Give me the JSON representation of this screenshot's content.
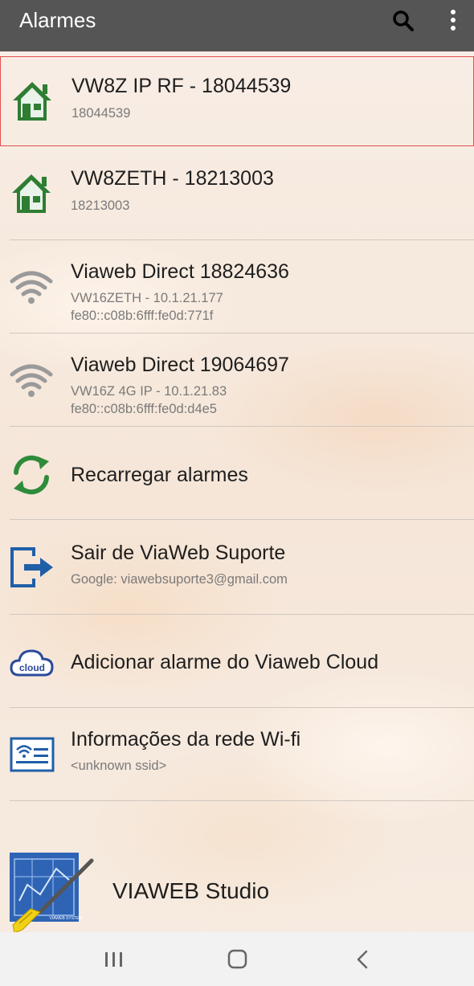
{
  "appbar": {
    "title": "Alarmes",
    "search_icon": "search-icon",
    "more_icon": "more-vert-icon"
  },
  "items": [
    {
      "icon": "house-icon",
      "title": "VW8Z IP RF - 18044539",
      "lines": [
        "18044539"
      ]
    },
    {
      "icon": "house-icon",
      "title": "VW8ZETH - 18213003",
      "lines": [
        "18213003"
      ]
    },
    {
      "icon": "wifi-icon",
      "title": "Viaweb Direct 18824636",
      "lines": [
        "VW16ZETH - 10.1.21.177",
        "fe80::c08b:6fff:fe0d:771f"
      ]
    },
    {
      "icon": "wifi-icon",
      "title": "Viaweb Direct 19064697",
      "lines": [
        "VW16Z 4G IP - 10.1.21.83",
        "fe80::c08b:6fff:fe0d:d4e5"
      ]
    },
    {
      "icon": "refresh-icon",
      "title": "Recarregar alarmes",
      "lines": []
    },
    {
      "icon": "logout-icon",
      "title": "Sair de ViaWeb Suporte",
      "lines": [
        "Google: viawebsuporte3@gmail.com"
      ]
    },
    {
      "icon": "cloud-icon",
      "icon_text": "cloud",
      "title": "Adicionar alarme do Viaweb Cloud",
      "lines": []
    },
    {
      "icon": "wifi-info-icon",
      "title": "Informações da rede Wi-fi",
      "lines": [
        "<unknown ssid>"
      ]
    }
  ],
  "studio": {
    "title": "VIAWEB Studio",
    "logo_text": "VIAWEB SYSTEM"
  },
  "colors": {
    "appbar": "#555555",
    "house_green": "#2e7d32",
    "refresh_green": "#2e8b3a",
    "blue": "#1f5fa8",
    "selected_border": "#e05050"
  },
  "navbar": {
    "recents_icon": "recents-icon",
    "home_icon": "home-icon",
    "back_icon": "back-icon"
  }
}
